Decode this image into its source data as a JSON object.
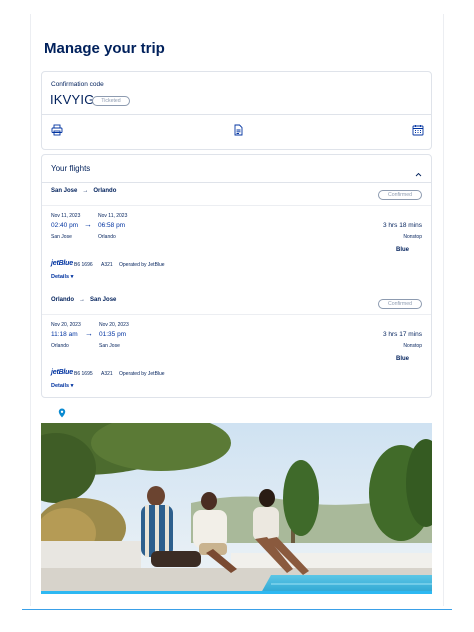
{
  "page_title": "Manage your trip",
  "confirmation": {
    "label": "Confirmation code",
    "code": "IKVYIG",
    "status": "Ticketed",
    "actions": [
      "print-icon",
      "document-icon",
      "calendar-icon"
    ]
  },
  "flights_section": {
    "title": "Your flights",
    "segments": [
      {
        "from": "San Jose",
        "to": "Orlando",
        "status": "Confirmed",
        "depart_date": "Nov 11, 2023",
        "arrive_date": "Nov 11, 2023",
        "depart_time": "02:40 pm",
        "arrive_time": "06:58 pm",
        "depart_city": "San Jose",
        "arrive_city": "Orlando",
        "duration": "3 hrs 18 mins",
        "stops": "Nonstop",
        "cabin": "Blue",
        "airline_logo": "jetBlue",
        "flight_number": "B6 1696",
        "aircraft": "A321",
        "operated_by": "Operated by JetBlue",
        "details_label": "Details ▾"
      },
      {
        "from": "Orlando",
        "to": "San Jose",
        "status": "Confirmed",
        "depart_date": "Nov 20, 2023",
        "arrive_date": "Nov 20, 2023",
        "depart_time": "11:18 am",
        "arrive_time": "01:35 pm",
        "depart_city": "Orlando",
        "arrive_city": "San Jose",
        "duration": "3 hrs 17 mins",
        "stops": "Nonstop",
        "cabin": "Blue",
        "airline_logo": "jetBlue",
        "flight_number": "B6 1695",
        "aircraft": "A321",
        "operated_by": "Operated by JetBlue",
        "details_label": "Details ▾"
      }
    ]
  },
  "icons": {
    "location": "map-pin-icon",
    "collapse": "chevron-up-icon"
  },
  "colors": {
    "brand_navy": "#00205b",
    "brand_blue": "#0033a0",
    "accent_cyan": "#2db8f2"
  }
}
